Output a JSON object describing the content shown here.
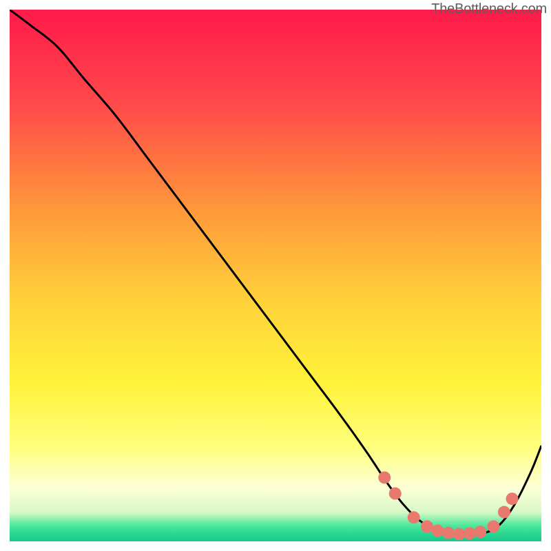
{
  "watermark": "TheBottleneck.com",
  "chart_data": {
    "type": "line",
    "title": "",
    "xlabel": "",
    "ylabel": "",
    "xlim": [
      0,
      100
    ],
    "ylim": [
      0,
      100
    ],
    "gradient_stops": [
      {
        "offset": 0,
        "color": "#ff1a4a"
      },
      {
        "offset": 0.18,
        "color": "#ff4a4a"
      },
      {
        "offset": 0.38,
        "color": "#ff9a3a"
      },
      {
        "offset": 0.55,
        "color": "#ffd23a"
      },
      {
        "offset": 0.7,
        "color": "#fff23a"
      },
      {
        "offset": 0.82,
        "color": "#ffff7a"
      },
      {
        "offset": 0.9,
        "color": "#fdffd6"
      },
      {
        "offset": 0.945,
        "color": "#d8f8c8"
      },
      {
        "offset": 0.97,
        "color": "#4de89a"
      },
      {
        "offset": 0.985,
        "color": "#2ad892"
      },
      {
        "offset": 1.0,
        "color": "#18c888"
      }
    ],
    "series": [
      {
        "name": "curve",
        "x": [
          0,
          4,
          9,
          14,
          20,
          26,
          32,
          38,
          44,
          50,
          56,
          62,
          67,
          71,
          74,
          77,
          80,
          83,
          86,
          89,
          92,
          95,
          98,
          100
        ],
        "y": [
          100,
          97,
          93,
          87,
          80,
          72,
          64,
          56,
          48,
          40,
          32,
          24,
          17,
          11,
          7,
          4,
          2.2,
          1.5,
          1.2,
          1.5,
          3,
          7,
          13,
          18
        ]
      }
    ],
    "markers": {
      "color": "#e9796f",
      "radius": 9,
      "points": [
        {
          "x": 70.5,
          "y": 12
        },
        {
          "x": 72.5,
          "y": 9
        },
        {
          "x": 76,
          "y": 4.5
        },
        {
          "x": 78.5,
          "y": 2.8
        },
        {
          "x": 80.5,
          "y": 2.0
        },
        {
          "x": 82.5,
          "y": 1.6
        },
        {
          "x": 84.5,
          "y": 1.4
        },
        {
          "x": 86.5,
          "y": 1.5
        },
        {
          "x": 88.5,
          "y": 1.8
        },
        {
          "x": 91,
          "y": 2.8
        },
        {
          "x": 93,
          "y": 5.5
        },
        {
          "x": 94.5,
          "y": 8
        }
      ]
    }
  }
}
